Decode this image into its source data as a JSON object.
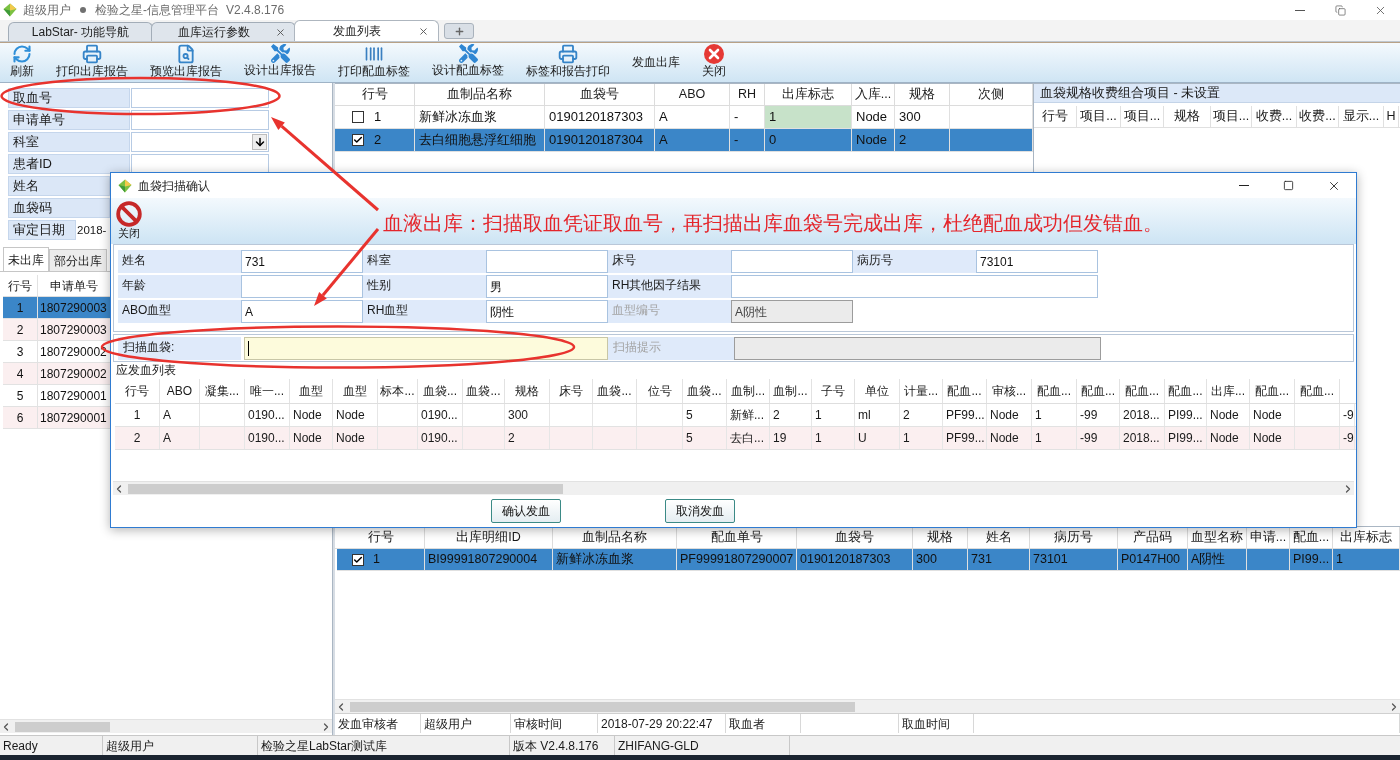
{
  "window": {
    "user": "超级用户",
    "title": "检验之星-信息管理平台",
    "version": "V2.4.8.176"
  },
  "tabs": [
    {
      "label": "LabStar- 功能导航",
      "selected": false,
      "closable": false
    },
    {
      "label": "血库运行参数",
      "selected": false,
      "closable": true
    },
    {
      "label": "发血列表",
      "selected": true,
      "closable": true
    }
  ],
  "toolbar": [
    {
      "label": "刷新",
      "kind": "refresh"
    },
    {
      "label": "打印出库报告",
      "kind": "print"
    },
    {
      "label": "预览出库报告",
      "kind": "preview"
    },
    {
      "label": "设计出库报告",
      "kind": "design"
    },
    {
      "label": "打印配血标签",
      "kind": "barcode"
    },
    {
      "label": "设计配血标签",
      "kind": "design"
    },
    {
      "label": "标签和报告打印",
      "kind": "print"
    },
    {
      "label": "发血出库",
      "kind": "text"
    },
    {
      "label": "关闭",
      "kind": "close"
    }
  ],
  "query_panel": {
    "fields": [
      {
        "label": "取血号",
        "kind": "input"
      },
      {
        "label": "申请单号",
        "kind": "input"
      },
      {
        "label": "科室",
        "kind": "dropdown"
      },
      {
        "label": "患者ID",
        "kind": "input"
      },
      {
        "label": "姓名",
        "kind": "label"
      },
      {
        "label": "血袋码",
        "kind": "label"
      },
      {
        "label": "审定日期",
        "kind": "text",
        "value": "2018-"
      }
    ],
    "tabs": [
      {
        "label": "未出库",
        "selected": true
      },
      {
        "label": "部分出库",
        "selected": false
      }
    ],
    "table": {
      "columns": [
        "行号",
        "申请单号"
      ],
      "rows": [
        {
          "cells": [
            "1",
            "1807290003"
          ],
          "selected": true
        },
        {
          "cells": [
            "2",
            "1807290003"
          ],
          "selected": false
        },
        {
          "cells": [
            "3",
            "1807290002"
          ],
          "selected": false
        },
        {
          "cells": [
            "4",
            "1807290002"
          ],
          "selected": false
        },
        {
          "cells": [
            "5",
            "1807290001"
          ],
          "selected": false
        },
        {
          "cells": [
            "6",
            "1807290001"
          ],
          "selected": false
        }
      ]
    }
  },
  "blood_bags": {
    "columns": [
      "行号",
      "血制品名称",
      "血袋号",
      "ABO",
      "RH",
      "出库标志",
      "入库...",
      "规格",
      "次侧"
    ],
    "rows": [
      {
        "checked": false,
        "selected": false,
        "flag_highlighted": true,
        "cells": [
          "1",
          "新鲜冰冻血浆",
          "0190120187303",
          "A",
          "-",
          "1",
          "Node",
          "300",
          null
        ]
      },
      {
        "checked": true,
        "selected": true,
        "flag_highlighted": false,
        "cells": [
          "2",
          "去白细胞悬浮红细胞",
          "0190120187304",
          "A",
          "-",
          "0",
          "Node",
          "2",
          null
        ]
      }
    ]
  },
  "fee_panel": {
    "title": "血袋规格收费组合项目 - 未设置",
    "columns": [
      "行号",
      "项目...",
      "项目...",
      "规格",
      "项目...",
      "收费...",
      "收费...",
      "显示...",
      "H"
    ]
  },
  "dialog": {
    "title": "血袋扫描确认",
    "close_label": "关闭",
    "field_rows": [
      [
        {
          "label": "姓名",
          "value": "731",
          "kind": "short",
          "disabled": false
        },
        {
          "label": "科室",
          "kind": "short",
          "disabled": false
        },
        {
          "label": "床号",
          "kind": "short",
          "disabled": false
        },
        {
          "label": "病历号",
          "value": "73101",
          "kind": "short",
          "disabled": false
        }
      ],
      [
        {
          "label": "年龄",
          "kind": "short",
          "disabled": false
        },
        {
          "label": "性别",
          "value": "男",
          "kind": "short",
          "disabled": false
        },
        {
          "label": "RH其他因子结果",
          "kind": "long",
          "disabled": false
        }
      ],
      [
        {
          "label": "ABO血型",
          "value": "A",
          "kind": "short",
          "disabled": false
        },
        {
          "label": "RH血型",
          "value": "阴性",
          "kind": "short",
          "disabled": false
        },
        {
          "label": "血型编号",
          "value": "A阴性",
          "kind": "short",
          "disabled": true
        }
      ]
    ],
    "scan_row": [
      {
        "label": "扫描血袋:",
        "focused": true,
        "disabled": false
      },
      {
        "label": "扫描提示",
        "focused": false,
        "disabled": true
      }
    ],
    "list_title": "应发血列表",
    "columns": [
      "行号",
      "ABO",
      "凝集...",
      "唯一...",
      "血型",
      "血型",
      "标本...",
      "血袋...",
      "血袋...",
      "规格",
      "床号",
      "血袋...",
      "位号",
      "血袋...",
      "血制...",
      "血制...",
      "子号",
      "单位",
      "计量...",
      "配血...",
      "审核...",
      "配血...",
      "配血...",
      "配血...",
      "配血...",
      "出库...",
      "配血...",
      "配血..."
    ],
    "rows": [
      [
        "1",
        "A",
        null,
        "0190...",
        "Node",
        "Node",
        null,
        "0190...",
        null,
        "300",
        null,
        null,
        null,
        "5",
        "新鲜...",
        "2",
        "1",
        "ml",
        "2",
        "PF99...",
        "Node",
        "1",
        "-99",
        "2018...",
        "PI99...",
        "Node",
        "Node",
        null,
        "-9"
      ],
      [
        "2",
        "A",
        null,
        "0190...",
        "Node",
        "Node",
        null,
        "0190...",
        null,
        "2",
        null,
        null,
        null,
        "5",
        "去白...",
        "19",
        "1",
        "U",
        "1",
        "PF99...",
        "Node",
        "1",
        "-99",
        "2018...",
        "PI99...",
        "Node",
        "Node",
        null,
        "-9"
      ]
    ],
    "buttons": [
      "确认发血",
      "取消发血"
    ]
  },
  "annotation": {
    "text": "血液出库：扫描取血凭证取血号，再扫描出库血袋号完成出库，杜绝配血成功但发错血。"
  },
  "issue_table": {
    "columns": [
      "行号",
      "出库明细ID",
      "血制品名称",
      "配血单号",
      "血袋号",
      "规格",
      "姓名",
      "病历号",
      "产品码",
      "血型名称",
      "申请...",
      "配血...",
      "出库标志"
    ],
    "rows": [
      {
        "checked": true,
        "selected": true,
        "cells": [
          "1",
          "BI99991807290004",
          "新鲜冰冻血浆",
          "PF99991807290007",
          "0190120187303",
          "300",
          "731",
          "73101",
          "P0147H00",
          "A阴性",
          null,
          "PI99...",
          "1"
        ]
      }
    ]
  },
  "issue_footer": [
    {
      "label": "发血审核者",
      "value": "超级用户"
    },
    {
      "label": "审核时间",
      "value": "2018-07-29 20:22:47"
    },
    {
      "label": "取血者"
    },
    {
      "label": "取血时间"
    }
  ],
  "status_bar": [
    "Ready",
    "超级用户",
    "检验之星LabStar测试库",
    "版本 V2.4.8.176",
    "ZHIFANG-GLD"
  ]
}
